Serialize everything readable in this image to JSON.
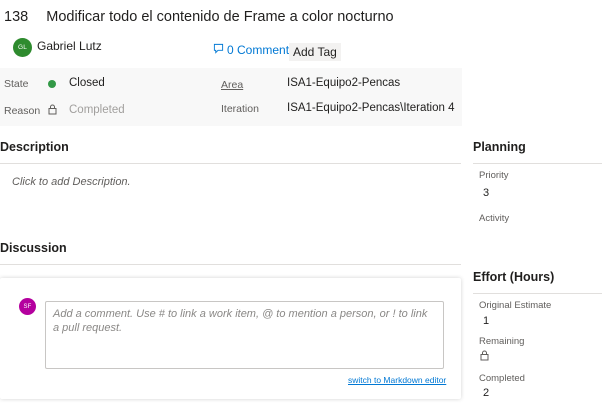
{
  "work_item": {
    "id": "138",
    "title": "Modificar todo el contenido de Frame a color nocturno"
  },
  "assignee": {
    "initials": "GL",
    "name": "Gabriel Lutz",
    "avatar_color": "#2e8b2e"
  },
  "header": {
    "comments_label": "0 Comments",
    "add_tag_label": "Add Tag"
  },
  "fields": {
    "state_label": "State",
    "state_value": "Closed",
    "state_color": "#339947",
    "reason_label": "Reason",
    "reason_value": "Completed",
    "area_label": "Area",
    "area_value": "ISA1-Equipo2-Pencas",
    "iteration_label": "Iteration",
    "iteration_value": "ISA1-Equipo2-Pencas\\Iteration 4"
  },
  "description": {
    "title": "Description",
    "placeholder": "Click to add Description."
  },
  "discussion": {
    "title": "Discussion",
    "user_initials": "SF",
    "user_avatar_color": "#b4009e",
    "placeholder": "Add a comment. Use # to link a work item, @ to mention a person, or ! to link a pull request.",
    "markdown_link": "switch to Markdown editor"
  },
  "planning": {
    "title": "Planning",
    "priority_label": "Priority",
    "priority_value": "3",
    "activity_label": "Activity"
  },
  "effort": {
    "title": "Effort (Hours)",
    "original_estimate_label": "Original Estimate",
    "original_estimate_value": "1",
    "remaining_label": "Remaining",
    "completed_label": "Completed",
    "completed_value": "2"
  }
}
